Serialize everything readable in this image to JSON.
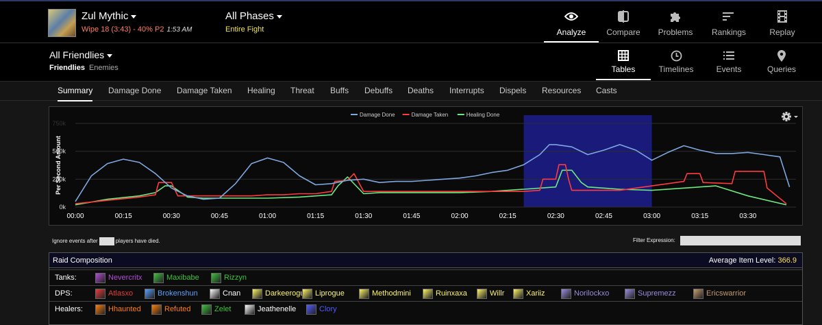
{
  "header": {
    "boss_name": "Zul Mythic",
    "boss_status": "Wipe 18 (3:43) - 40% P2",
    "boss_time": "1:53 AM",
    "phase": "All Phases",
    "phase_sub": "Entire Fight",
    "nav": [
      {
        "label": "Analyze",
        "icon": "eye-icon"
      },
      {
        "label": "Compare",
        "icon": "compare-icon"
      },
      {
        "label": "Problems",
        "icon": "puzzle-icon"
      },
      {
        "label": "Rankings",
        "icon": "rankings-icon"
      },
      {
        "label": "Replay",
        "icon": "film-icon"
      }
    ]
  },
  "subheader": {
    "title": "All Friendlies",
    "friendlies": "Friendlies",
    "enemies": "Enemies",
    "nav": [
      {
        "label": "Tables",
        "icon": "table-icon"
      },
      {
        "label": "Timelines",
        "icon": "clock-icon"
      },
      {
        "label": "Events",
        "icon": "list-icon"
      },
      {
        "label": "Queries",
        "icon": "map-pin-icon"
      }
    ]
  },
  "tabs": [
    "Summary",
    "Damage Done",
    "Damage Taken",
    "Healing",
    "Threat",
    "Buffs",
    "Debuffs",
    "Deaths",
    "Interrupts",
    "Dispels",
    "Resources",
    "Casts"
  ],
  "chart_data": {
    "type": "line",
    "ylabel": "Per Second Amount",
    "y_ticks": [
      "0k",
      "250k",
      "500k",
      "750k"
    ],
    "x_ticks": [
      "00:00",
      "00:15",
      "00:30",
      "00:45",
      "01:00",
      "01:15",
      "01:30",
      "01:45",
      "02:00",
      "02:15",
      "02:30",
      "02:45",
      "03:00",
      "03:15",
      "03:30"
    ],
    "highlight_range": [
      "02:20",
      "03:00"
    ],
    "legend_position": "top",
    "colors": {
      "Damage Done": "#7ea8e0",
      "Damage Taken": "#ff3b3b",
      "Healing Done": "#6de882",
      "highlight": "#1a1a7a"
    },
    "series": [
      {
        "name": "Damage Done",
        "x": [
          0,
          5,
          10,
          15,
          20,
          25,
          30,
          35,
          40,
          45,
          50,
          55,
          60,
          65,
          70,
          75,
          80,
          85,
          90,
          95,
          100,
          105,
          110,
          115,
          120,
          125,
          130,
          135,
          140,
          145,
          148,
          150,
          155,
          160,
          165,
          170,
          175,
          180,
          185,
          190,
          195,
          200,
          205,
          210,
          215,
          220,
          223
        ],
        "y": [
          50,
          280,
          390,
          430,
          400,
          300,
          170,
          100,
          70,
          80,
          210,
          390,
          440,
          400,
          280,
          200,
          210,
          240,
          250,
          220,
          230,
          230,
          240,
          250,
          260,
          280,
          310,
          330,
          380,
          470,
          560,
          560,
          540,
          470,
          510,
          560,
          510,
          420,
          490,
          550,
          510,
          480,
          480,
          490,
          470,
          450,
          180
        ]
      },
      {
        "name": "Damage Taken",
        "x": [
          0,
          10,
          20,
          25,
          26,
          30,
          32,
          40,
          50,
          55,
          60,
          65,
          70,
          75,
          80,
          81,
          85,
          87,
          90,
          95,
          100,
          105,
          110,
          130,
          140,
          145,
          146,
          150,
          151,
          153,
          154,
          155,
          160,
          170,
          175,
          180,
          185,
          190,
          191,
          195,
          196,
          205,
          206,
          215,
          216,
          222
        ],
        "y": [
          30,
          60,
          90,
          110,
          220,
          220,
          100,
          100,
          100,
          100,
          110,
          110,
          120,
          120,
          140,
          230,
          240,
          300,
          140,
          140,
          140,
          140,
          140,
          140,
          140,
          150,
          250,
          250,
          380,
          380,
          250,
          150,
          150,
          150,
          170,
          190,
          210,
          230,
          300,
          300,
          220,
          210,
          320,
          320,
          170,
          30
        ]
      },
      {
        "name": "Healing Done",
        "x": [
          0,
          10,
          20,
          25,
          28,
          30,
          35,
          40,
          50,
          60,
          70,
          80,
          82,
          85,
          90,
          95,
          100,
          110,
          120,
          130,
          140,
          150,
          152,
          155,
          158,
          160,
          170,
          180,
          190,
          200,
          210,
          222
        ],
        "y": [
          20,
          70,
          100,
          130,
          190,
          190,
          90,
          80,
          80,
          80,
          90,
          110,
          190,
          270,
          120,
          130,
          130,
          130,
          130,
          140,
          160,
          180,
          330,
          330,
          220,
          180,
          160,
          150,
          170,
          190,
          100,
          20
        ]
      }
    ],
    "xlim": [
      0,
      225
    ],
    "ylim": [
      0,
      750
    ]
  },
  "controls": {
    "ignore_prefix": "Ignore events after",
    "ignore_suffix": "players have died.",
    "filter_label": "Filter Expression:"
  },
  "raid": {
    "title": "Raid Composition",
    "ilvl_label": "Average Item Level: ",
    "ilvl_value": "366.9",
    "tanks_label": "Tanks:",
    "dps_label": "DPS:",
    "healers_label": "Healers:",
    "tanks": [
      {
        "name": "Nevercritx",
        "color": "#b44bd6"
      },
      {
        "name": "Maxibabe",
        "color": "#3ec23e"
      },
      {
        "name": "Rizzyn",
        "color": "#3ec23e"
      }
    ],
    "dps": [
      {
        "name": "Atlasxo",
        "color": "#e83b3b"
      },
      {
        "name": "Brokenshun",
        "color": "#5aa0ff"
      },
      {
        "name": "Cnan",
        "color": "#ffffff"
      },
      {
        "name": "Darkeerogue",
        "color": "#fff568"
      },
      {
        "name": "Liprogue",
        "color": "#fff568"
      },
      {
        "name": "Methodmini",
        "color": "#fff568"
      },
      {
        "name": "Ruinxaxa",
        "color": "#fff568"
      },
      {
        "name": "Willr",
        "color": "#fff568"
      },
      {
        "name": "Xariiz",
        "color": "#fff568"
      },
      {
        "name": "Norilockxo",
        "color": "#9b8ce0"
      },
      {
        "name": "Supremezz",
        "color": "#9b8ce0"
      },
      {
        "name": "Ericswarrior",
        "color": "#c79c6e"
      }
    ],
    "healers": [
      {
        "name": "Hhaunted",
        "color": "#ff7d0a"
      },
      {
        "name": "Refuted",
        "color": "#ff7d0a"
      },
      {
        "name": "Zelet",
        "color": "#3ec23e"
      },
      {
        "name": "Jeathenelle",
        "color": "#ffffff"
      },
      {
        "name": "Clory",
        "color": "#4f5bff"
      }
    ]
  }
}
